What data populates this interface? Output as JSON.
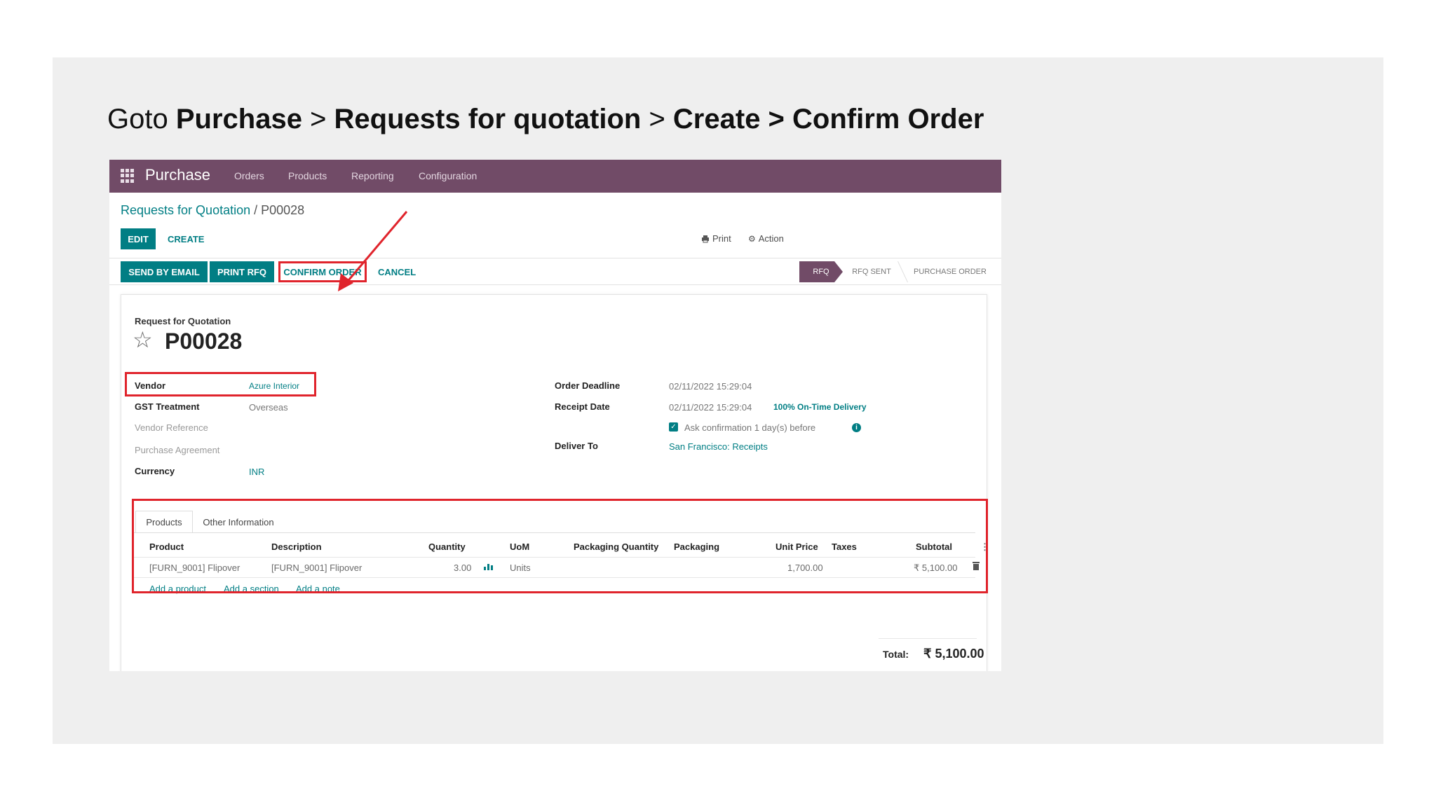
{
  "slide": {
    "heading_prefix": "Goto ",
    "heading_parts": [
      "Purchase",
      " > ",
      "Requests for quotation",
      " > ",
      "Create",
      " > ",
      "Confirm Order"
    ]
  },
  "navbar": {
    "brand": "Purchase",
    "items": [
      "Orders",
      "Products",
      "Reporting",
      "Configuration"
    ],
    "color": "#714b67"
  },
  "breadcrumb": {
    "parent": "Requests for Quotation",
    "separator": " / ",
    "current": "P00028"
  },
  "control_panel": {
    "edit": "EDIT",
    "create": "CREATE",
    "print": "Print",
    "action": "Action"
  },
  "header_buttons": {
    "send_by_email": "SEND BY EMAIL",
    "print_rfq": "PRINT RFQ",
    "confirm_order": "CONFIRM ORDER",
    "cancel": "CANCEL"
  },
  "statusbar": [
    "RFQ",
    "RFQ SENT",
    "PURCHASE ORDER"
  ],
  "form": {
    "doc_kind": "Request for Quotation",
    "name": "P00028",
    "left_fields": [
      {
        "label": "Vendor",
        "value": "Azure Interior"
      },
      {
        "label": "GST Treatment",
        "value": "Overseas"
      },
      {
        "label": "Vendor Reference",
        "value": ""
      },
      {
        "label": "Purchase Agreement",
        "value": ""
      },
      {
        "label": "Currency",
        "value": "INR"
      }
    ],
    "right_fields": {
      "order_deadline_label": "Order Deadline",
      "order_deadline": "02/11/2022 15:29:04",
      "receipt_date_label": "Receipt Date",
      "receipt_date": "02/11/2022 15:29:04",
      "on_time": "100% On-Time Delivery",
      "ask_confirmation": "Ask confirmation  1  day(s) before",
      "deliver_to_label": "Deliver To",
      "deliver_to": "San Francisco: Receipts"
    },
    "tabs": [
      "Products",
      "Other Information"
    ],
    "columns": [
      "Product",
      "Description",
      "Quantity",
      "UoM",
      "Packaging Quantity",
      "Packaging",
      "Unit Price",
      "Taxes",
      "Subtotal"
    ],
    "lines": [
      {
        "product": "[FURN_9001] Flipover",
        "description": "[FURN_9001] Flipover",
        "quantity": "3.00",
        "uom": "Units",
        "packaging_quantity": "",
        "packaging": "",
        "unit_price": "1,700.00",
        "taxes": "",
        "subtotal": "₹ 5,100.00"
      }
    ],
    "add_links": [
      "Add a product",
      "Add a section",
      "Add a note"
    ],
    "total_label": "Total:",
    "total_value": "₹ 5,100.00"
  },
  "icons": {
    "apps": "grid-icon",
    "print": "printer-icon",
    "action": "gear-icon",
    "favorite": "star-icon",
    "forecast": "chart-icon",
    "delete": "trash-icon",
    "info": "info-icon",
    "column_options": "kebab-icon"
  },
  "colors": {
    "brand": "#714b67",
    "accent": "#017e84",
    "highlight": "#e0242c"
  }
}
